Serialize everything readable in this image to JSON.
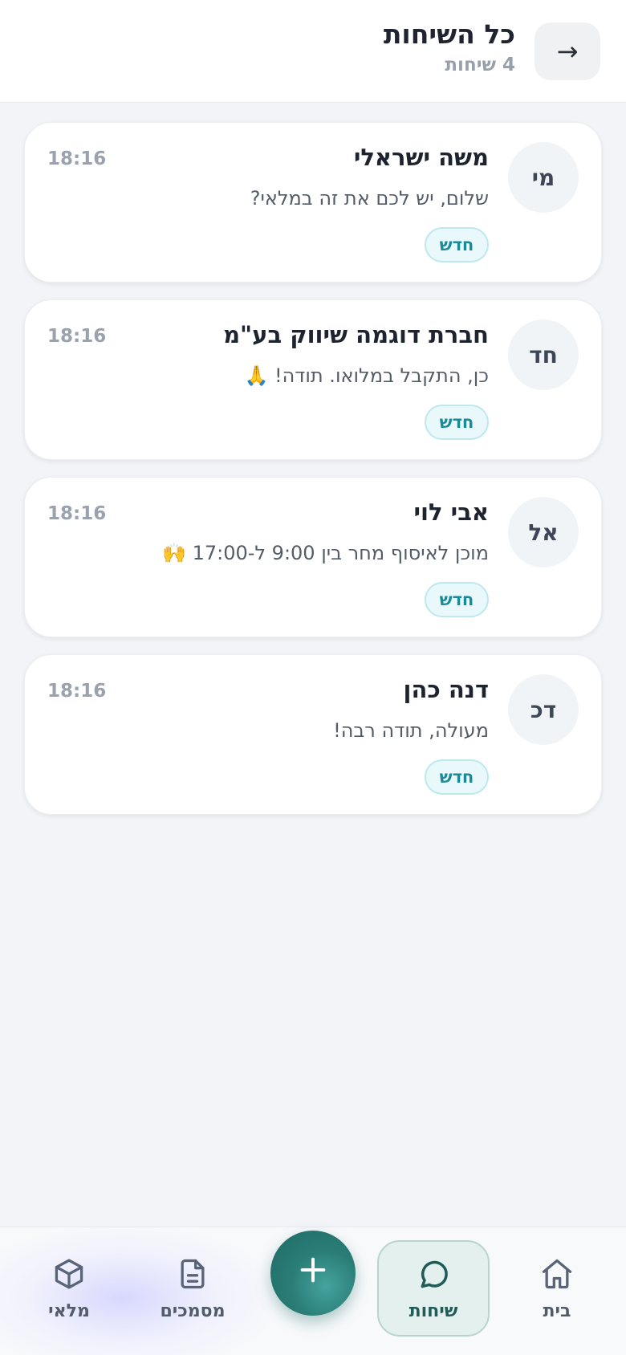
{
  "header": {
    "title": "כל השיחות",
    "subtitle": "4 שיחות",
    "back_icon": "→"
  },
  "conversations": [
    {
      "initials": "מי",
      "name": "משה ישראלי",
      "preview": "שלום, יש לכם את זה במלאי?",
      "time": "18:16",
      "badge": "חדש"
    },
    {
      "initials": "חד",
      "name": "חברת דוגמה שיווק בע\"מ",
      "preview": "כן, התקבל במלואו. תודה! 🙏",
      "time": "18:16",
      "badge": "חדש"
    },
    {
      "initials": "אל",
      "name": "אבי לוי",
      "preview": "מוכן לאיסוף מחר בין 9:00 ל-17:00 🙌",
      "time": "18:16",
      "badge": "חדש"
    },
    {
      "initials": "דכ",
      "name": "דנה כהן",
      "preview": "מעולה, תודה רבה!",
      "time": "18:16",
      "badge": "חדש"
    }
  ],
  "nav": {
    "home": "בית",
    "chats": "שיחות",
    "documents": "מסמכים",
    "inventory": "מלאי",
    "add_icon": "plus-icon",
    "active": "chats",
    "accent": "#2a7d77"
  }
}
